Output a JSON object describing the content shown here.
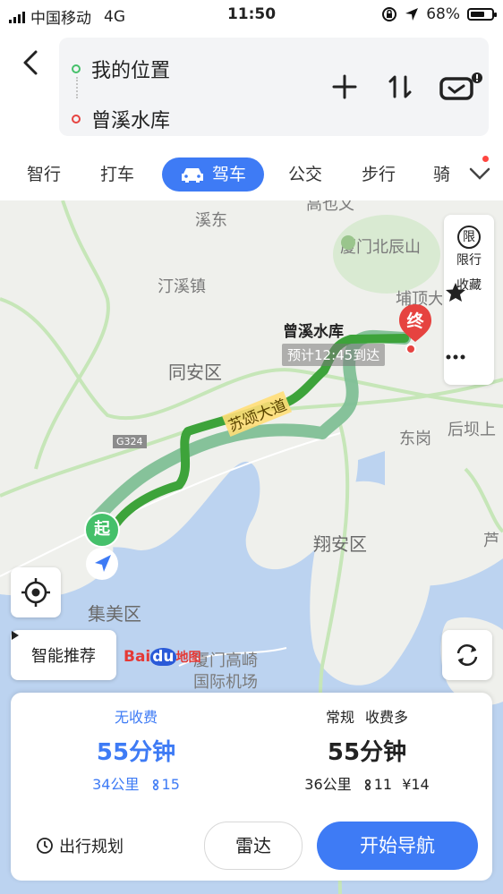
{
  "status_bar": {
    "carrier": "中国移动",
    "network": "4G",
    "time": "11:50",
    "battery": "68%",
    "battery_level": 0.68
  },
  "route": {
    "origin": "我的位置",
    "destination": "曾溪水库"
  },
  "tabs": [
    {
      "label": "智行"
    },
    {
      "label": "打车"
    },
    {
      "label": "驾车"
    },
    {
      "label": "公交"
    },
    {
      "label": "步行"
    },
    {
      "label": "骑"
    }
  ],
  "map": {
    "labels": {
      "xidong": "溪东",
      "gaoyi": "高也文",
      "xiamen_north": "厦门北辰山",
      "tingxi": "汀溪镇",
      "budingda": "埔顶大",
      "tongan": "同安区",
      "sushuo": "苏颂大道",
      "g324": "G324",
      "donggang": "东岗",
      "houba": "后坝上",
      "xiangan": "翔安区",
      "lu": "芦",
      "jimei": "集美区",
      "airport1": "厦门高崎",
      "airport2": "国际机场"
    },
    "destination_title": "曾溪水库",
    "eta": "预计12:45到达",
    "start_marker": "起",
    "end_marker": "终",
    "side_panel": {
      "restrict": "限行",
      "restrict_icon_text": "限",
      "favorite": "收藏"
    },
    "smart_recommend": "智能推荐",
    "logo": {
      "part1": "Bai",
      "part2": "du",
      "part3": "地图"
    }
  },
  "plans": [
    {
      "tag": "无收费",
      "time": "55分钟",
      "distance": "34公里",
      "lights": "15",
      "toll": ""
    },
    {
      "tag": "常规",
      "tag2": "收费多",
      "time": "55分钟",
      "distance": "36公里",
      "lights": "11",
      "toll": "¥14"
    }
  ],
  "actions": {
    "trip_plan": "出行规划",
    "radar": "雷达",
    "start": "开始导航"
  },
  "colors": {
    "accent": "#3e7bf5",
    "route_main": "#3da33a",
    "route_alt": "#7fbf96",
    "origin": "#45c06a",
    "destination": "#e64340"
  }
}
